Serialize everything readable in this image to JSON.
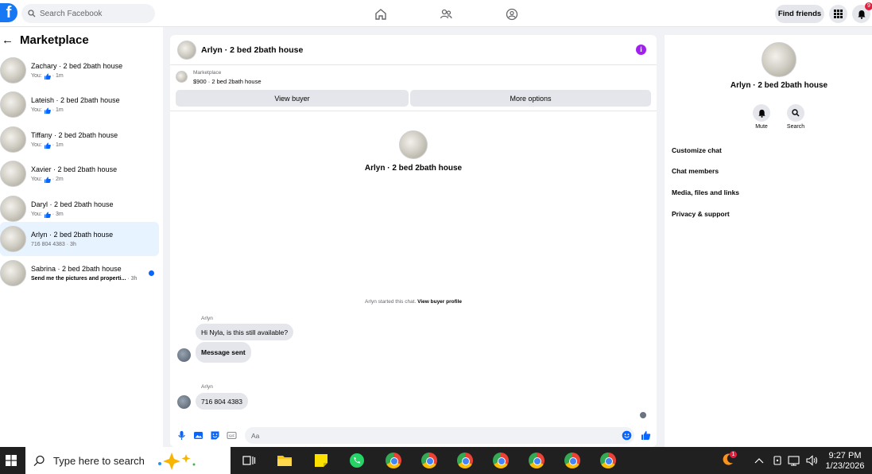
{
  "topbar": {
    "logo": "f",
    "search_placeholder": "Search Facebook",
    "find_friends": "Find friends",
    "notification_count": "9"
  },
  "sidebar": {
    "title": "Marketplace",
    "conversations": [
      {
        "title": "Zachary · 2 bed 2bath house",
        "prefix": "You:",
        "time": "· 1m",
        "like": true
      },
      {
        "title": "Lateish · 2 bed 2bath house",
        "prefix": "You:",
        "time": "· 1m",
        "like": true
      },
      {
        "title": "Tiffany · 2 bed 2bath house",
        "prefix": "You:",
        "time": "· 1m",
        "like": true
      },
      {
        "title": "Xavier · 2 bed 2bath house",
        "prefix": "You:",
        "time": "· 2m",
        "like": true
      },
      {
        "title": "Daryl · 2 bed 2bath house",
        "prefix": "You:",
        "time": "· 3m",
        "like": true
      },
      {
        "title": "Arlyn · 2 bed 2bath house",
        "prefix": "716 804 4383",
        "time": "· 3h",
        "like": false
      },
      {
        "title": "Sabrina · 2 bed 2bath house",
        "prefix": "Send me the pictures and properti...",
        "time": "· 3h",
        "like": false
      }
    ]
  },
  "chat": {
    "title": "Arlyn · 2 bed 2bath house",
    "listing_source": "Marketplace",
    "listing_desc": "$900 · 2 bed 2bath house",
    "view_buyer": "View buyer",
    "more_options": "More options",
    "profile_name": "Arlyn · 2 bed 2bath house",
    "started_text": "Arlyn started this chat.",
    "view_buyer_profile": "View buyer profile",
    "sender_name": "Arlyn",
    "msg1": "Hi Nyla, is this still available?",
    "msg2": "Message sent",
    "msg3": "716 804 4383",
    "composer_placeholder": "Aa"
  },
  "right_panel": {
    "name": "Arlyn · 2 bed 2bath house",
    "mute": "Mute",
    "search": "Search",
    "items": [
      "Customize chat",
      "Chat members",
      "Media, files and links",
      "Privacy & support"
    ]
  },
  "taskbar": {
    "search_placeholder": "Type here to search",
    "time": "9:27 PM",
    "date": "1/23/2026",
    "weather_badge": "1"
  },
  "colors": {
    "accent": "#0866ff",
    "brand": "#1877f2",
    "info": "#a020f0"
  }
}
